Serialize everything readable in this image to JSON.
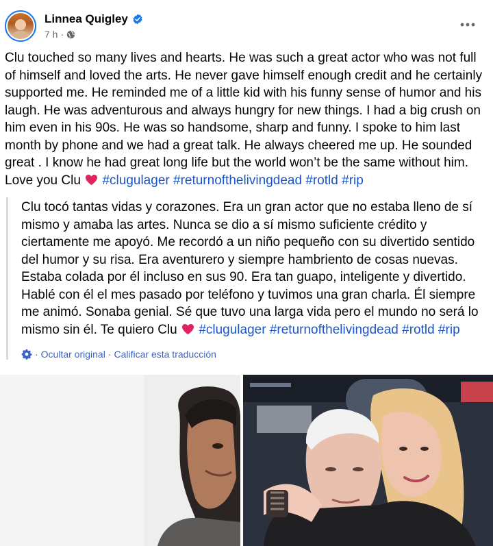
{
  "post": {
    "author": "Linnea Quigley",
    "timestamp": "7 h",
    "separator": "·",
    "body_segments": [
      {
        "type": "text",
        "value": "Clu touched so many lives and hearts. He was such a great actor who was not full of himself and loved the arts. He never gave himself enough credit and he certainly supported me. He reminded me of a little kid with his funny sense of humor and his laugh. He was adventurous and always hungry for new things. I had a big crush on him even in his 90s. He was so handsome, sharp and funny. I spoke to him last month by phone and we had a great talk. He always cheered me up. He sounded great . I know he had great long life but the world won’t be the same without him. Love you Clu "
      },
      {
        "type": "heart"
      },
      {
        "type": "text",
        "value": " "
      },
      {
        "type": "hashtag",
        "value": "#clugulager"
      },
      {
        "type": "text",
        "value": " "
      },
      {
        "type": "hashtag",
        "value": "#returnofthelivingdead"
      },
      {
        "type": "text",
        "value": " "
      },
      {
        "type": "hashtag",
        "value": "#rotld"
      },
      {
        "type": "text",
        "value": " "
      },
      {
        "type": "hashtag",
        "value": "#rip"
      }
    ],
    "translation_segments": [
      {
        "type": "text",
        "value": "Clu tocó tantas vidas y corazones. Era un gran actor que no estaba lleno de sí mismo y amaba las artes. Nunca se dio a sí mismo suficiente crédito y ciertamente me apoyó. Me recordó a un niño pequeño con su divertido sentido del humor y su risa. Era aventurero y siempre hambriento de cosas nuevas. Estaba colada por él incluso en sus 90. Era tan guapo, inteligente y divertido. Hablé con él el mes pasado por teléfono y tuvimos una gran charla. Él siempre me animó. Sonaba genial. Sé que tuvo una larga vida pero el mundo no será lo mismo sin él. Te quiero Clu "
      },
      {
        "type": "heart"
      },
      {
        "type": "text",
        "value": " "
      },
      {
        "type": "hashtag",
        "value": "#clugulager"
      },
      {
        "type": "text",
        "value": " "
      },
      {
        "type": "hashtag",
        "value": "#returnofthelivingdead"
      },
      {
        "type": "text",
        "value": " "
      },
      {
        "type": "hashtag",
        "value": "#rotld"
      },
      {
        "type": "text",
        "value": " "
      },
      {
        "type": "hashtag",
        "value": "#rip"
      }
    ],
    "translation_actions": {
      "hide_original": "Ocultar original",
      "separator": "·",
      "rate_translation": "Calificar esta traducción"
    }
  },
  "icons": {
    "verified": "verified-badge-icon",
    "audience": "globe-icon",
    "more": "more-options-icon",
    "settings": "gear-icon",
    "heart": "red-heart-emoji-icon"
  },
  "colors": {
    "brand_blue": "#1877f2",
    "hashtag_blue": "#1a55c9",
    "secondary_text": "#65676b",
    "heart_red": "#e0245e"
  }
}
